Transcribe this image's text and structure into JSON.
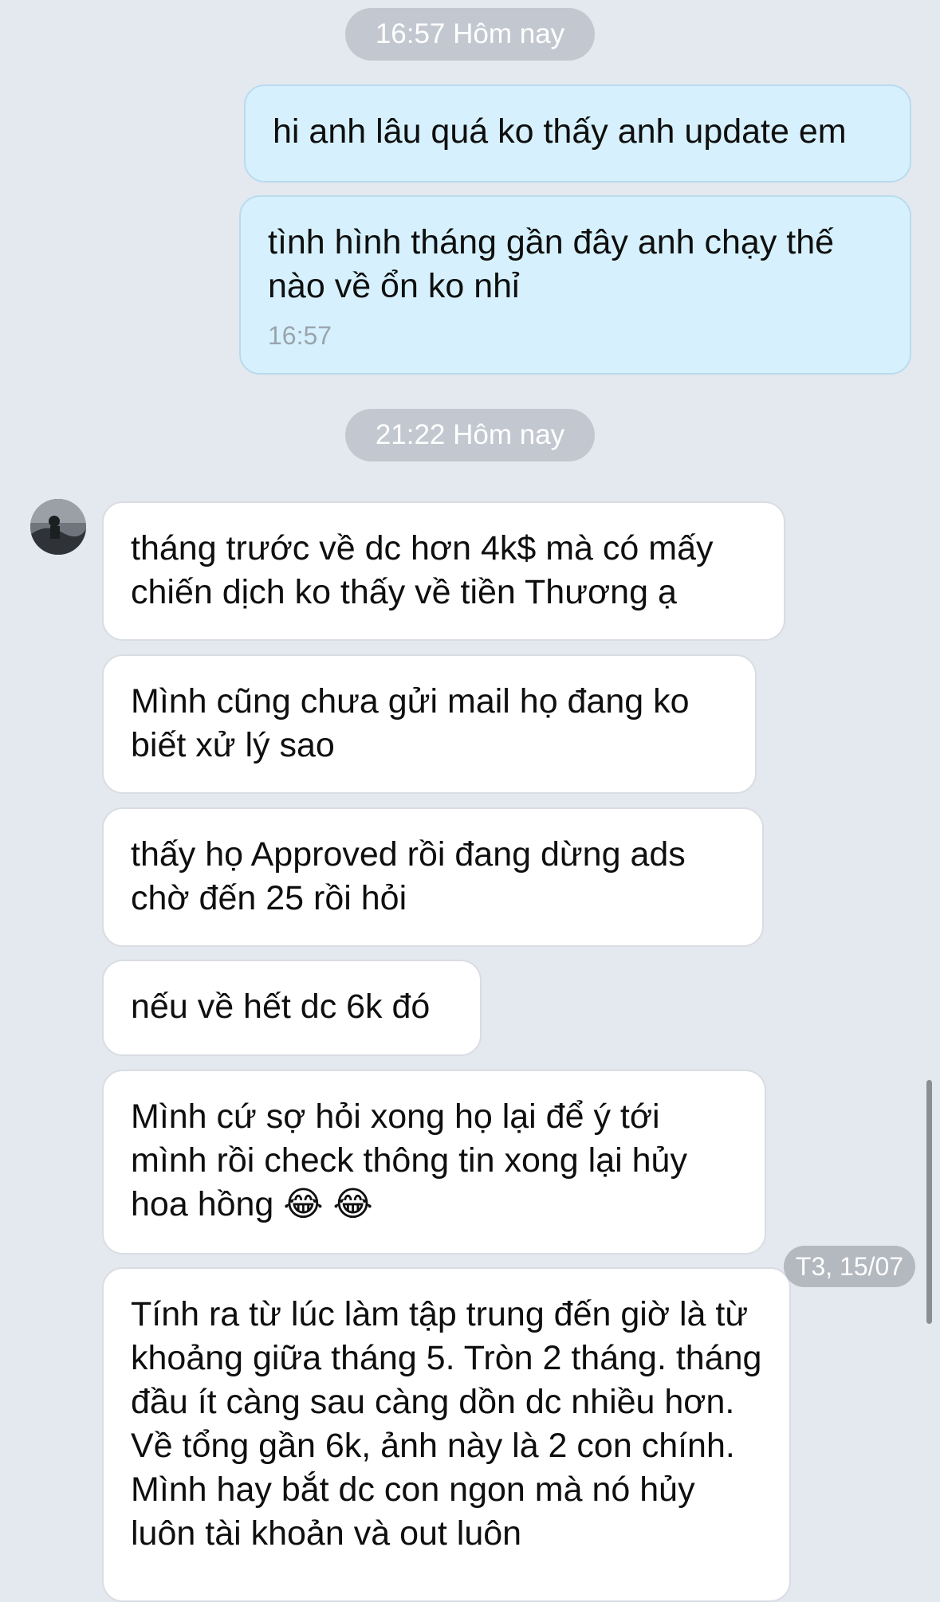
{
  "separators": [
    {
      "label": "16:57 Hôm nay"
    },
    {
      "label": "21:22 Hôm nay"
    }
  ],
  "sent_messages": [
    {
      "text": "hi anh lâu quá ko thấy anh update em"
    },
    {
      "text": "tình hình tháng gần đây anh chạy thế nào về ổn ko nhỉ",
      "time": "16:57"
    }
  ],
  "received_messages": [
    {
      "text": "tháng trước về dc hơn 4k$ mà có mấy chiến dịch ko thấy về tiền Thương ạ"
    },
    {
      "text": "Mình cũng chưa gửi mail họ đang ko biết xử lý sao"
    },
    {
      "text": "thấy họ Approved rồi đang dừng ads chờ đến 25 rồi hỏi"
    },
    {
      "text": "nếu về hết dc 6k đó"
    },
    {
      "text": "Mình cứ sợ hỏi xong họ lại để ý tới mình rồi check thông tin xong lại hủy hoa hồng 😂 😂"
    },
    {
      "text": "Tính ra từ lúc làm tập trung đến giờ là từ khoảng giữa tháng 5. Tròn 2 tháng. tháng đầu ít càng sau càng dồn dc nhiều hơn. Về tổng gần 6k, ảnh này là 2 con chính. Mình hay bắt dc con ngon mà nó hủy luôn tài khoản và out luôn"
    }
  ],
  "date_badge": "T3, 15/07",
  "colors": {
    "background": "#e4e8ef",
    "sent_bubble": "#d6f1fd",
    "received_bubble": "#ffffff",
    "time_pill": "#c3c8d0"
  },
  "icons": {
    "avatar": "profile-photo",
    "scrollbar": "scroll-indicator"
  }
}
